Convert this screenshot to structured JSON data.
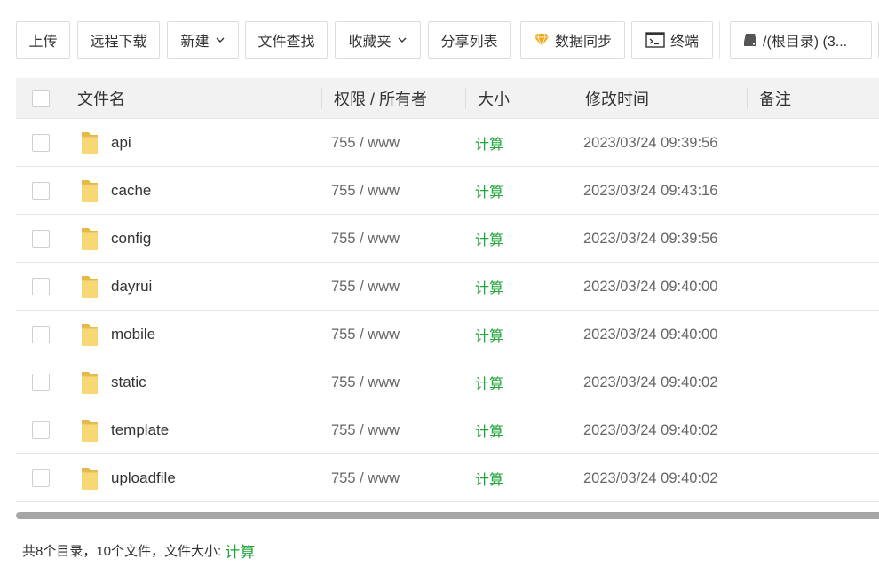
{
  "toolbar": {
    "upload": "上传",
    "remote_download": "远程下载",
    "new": "新建",
    "file_search": "文件查找",
    "favorites": "收藏夹",
    "share_list": "分享列表",
    "data_sync": "数据同步",
    "terminal": "终端",
    "path": "/(根目录) (3..."
  },
  "table": {
    "headers": {
      "name": "文件名",
      "perm_owner": "权限 / 所有者",
      "size": "大小",
      "modified": "修改时间",
      "note": "备注"
    },
    "rows": [
      {
        "name": "api",
        "perm": "755 / www",
        "size": "计算",
        "modified": "2023/03/24 09:39:56"
      },
      {
        "name": "cache",
        "perm": "755 / www",
        "size": "计算",
        "modified": "2023/03/24 09:43:16"
      },
      {
        "name": "config",
        "perm": "755 / www",
        "size": "计算",
        "modified": "2023/03/24 09:39:56"
      },
      {
        "name": "dayrui",
        "perm": "755 / www",
        "size": "计算",
        "modified": "2023/03/24 09:40:00"
      },
      {
        "name": "mobile",
        "perm": "755 / www",
        "size": "计算",
        "modified": "2023/03/24 09:40:00"
      },
      {
        "name": "static",
        "perm": "755 / www",
        "size": "计算",
        "modified": "2023/03/24 09:40:02"
      },
      {
        "name": "template",
        "perm": "755 / www",
        "size": "计算",
        "modified": "2023/03/24 09:40:02"
      },
      {
        "name": "uploadfile",
        "perm": "755 / www",
        "size": "计算",
        "modified": "2023/03/24 09:40:02"
      }
    ]
  },
  "footer": {
    "summary": "共8个目录，10个文件，文件大小:",
    "calc": "计算"
  },
  "colors": {
    "accent_green": "#20a53a",
    "folder_yellow": "#f8d775",
    "diamond_gold": "#f0a818"
  },
  "icons": [
    "chevron-down-icon",
    "diamond-icon",
    "terminal-icon",
    "drive-icon",
    "folder-icon"
  ]
}
